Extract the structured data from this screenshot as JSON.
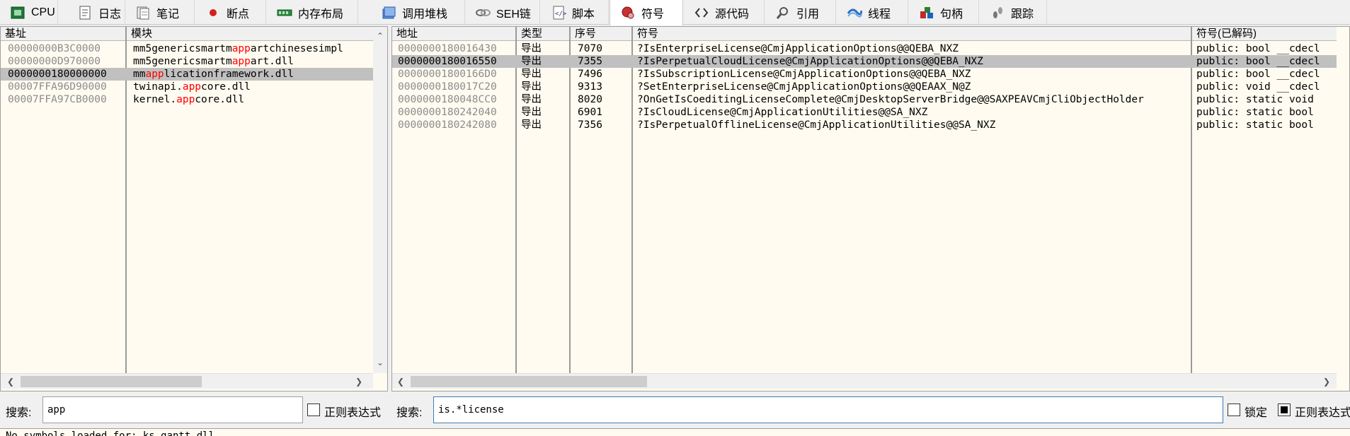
{
  "tabs": [
    {
      "label": "CPU",
      "icon": "cpu-icon"
    },
    {
      "label": "日志",
      "icon": "log-icon"
    },
    {
      "label": "笔记",
      "icon": "notes-icon"
    },
    {
      "label": "断点",
      "icon": "breakpoint-icon"
    },
    {
      "label": "内存布局",
      "icon": "memory-map-icon"
    },
    {
      "label": "调用堆栈",
      "icon": "call-stack-icon"
    },
    {
      "label": "SEH链",
      "icon": "seh-chain-icon"
    },
    {
      "label": "脚本",
      "icon": "script-icon"
    },
    {
      "label": "符号",
      "icon": "symbols-icon"
    },
    {
      "label": "源代码",
      "icon": "source-icon"
    },
    {
      "label": "引用",
      "icon": "references-icon"
    },
    {
      "label": "线程",
      "icon": "threads-icon"
    },
    {
      "label": "句柄",
      "icon": "handles-icon"
    },
    {
      "label": "跟踪",
      "icon": "trace-icon"
    }
  ],
  "active_tab": "符号",
  "modules_pane": {
    "headers": {
      "base": "基址",
      "module": "模块"
    },
    "rows": [
      {
        "base": "00000000B3C0000",
        "pre": "mm5genericsmartm",
        "hl": "app",
        "post": "artchinesesimpl",
        "selected": false
      },
      {
        "base": "00000000D970000",
        "pre": "mm5genericsmartm",
        "hl": "app",
        "post": "art.dll",
        "selected": false
      },
      {
        "base": "0000000180000000",
        "pre": "mm",
        "hl": "app",
        "post": "licationframework.dll",
        "selected": true
      },
      {
        "base": "00007FFA96D90000",
        "pre": "twinapi.",
        "hl": "app",
        "post": "core.dll",
        "selected": false
      },
      {
        "base": "00007FFA97CB0000",
        "pre": "kernel.",
        "hl": "app",
        "post": "core.dll",
        "selected": false
      }
    ]
  },
  "symbols_pane": {
    "headers": {
      "address": "地址",
      "type": "类型",
      "ordinal": "序号",
      "symbol": "符号",
      "decoded": "符号(已解码)"
    },
    "rows": [
      {
        "address": "0000000180016430",
        "type": "导出",
        "ordinal": "7070",
        "symbol": "?IsEnterpriseLicense@CmjApplicationOptions@@QEBA_NXZ",
        "decoded": "public: bool __cdecl",
        "selected": false
      },
      {
        "address": "0000000180016550",
        "type": "导出",
        "ordinal": "7355",
        "symbol": "?IsPerpetualCloudLicense@CmjApplicationOptions@@QEBA_NXZ",
        "decoded": "public: bool __cdecl",
        "selected": true
      },
      {
        "address": "00000001800166D0",
        "type": "导出",
        "ordinal": "7496",
        "symbol": "?IsSubscriptionLicense@CmjApplicationOptions@@QEBA_NXZ",
        "decoded": "public: bool __cdecl",
        "selected": false
      },
      {
        "address": "0000000180017C20",
        "type": "导出",
        "ordinal": "9313",
        "symbol": "?SetEnterpriseLicense@CmjApplicationOptions@@QEAAX_N@Z",
        "decoded": "public: void __cdecl",
        "selected": false
      },
      {
        "address": "0000000180048CC0",
        "type": "导出",
        "ordinal": "8020",
        "symbol": "?OnGetIsCoeditingLicenseComplete@CmjDesktopServerBridge@@SAXPEAVCmjCliObjectHolder",
        "decoded": "public: static void",
        "selected": false
      },
      {
        "address": "0000000180242040",
        "type": "导出",
        "ordinal": "6901",
        "symbol": "?IsCloudLicense@CmjApplicationUtilities@@SA_NXZ",
        "decoded": "public: static bool",
        "selected": false
      },
      {
        "address": "0000000180242080",
        "type": "导出",
        "ordinal": "7356",
        "symbol": "?IsPerpetualOfflineLicense@CmjApplicationUtilities@@SA_NXZ",
        "decoded": "public: static bool",
        "selected": false
      }
    ]
  },
  "search_left": {
    "label": "搜索:",
    "value": "app",
    "regex_label": "正则表达式",
    "regex_checked": false
  },
  "search_right": {
    "label": "搜索:",
    "value": "is.*license",
    "lock_label": "锁定",
    "lock_checked": false,
    "regex_label": "正则表达式",
    "regex_checked": true
  },
  "status_text": "No symbols loaded for: ks_gantt.dll",
  "colors": {
    "highlight": "#ff0000",
    "pane_bg": "#fffbf0",
    "selected_row": "#c0c0c0"
  }
}
